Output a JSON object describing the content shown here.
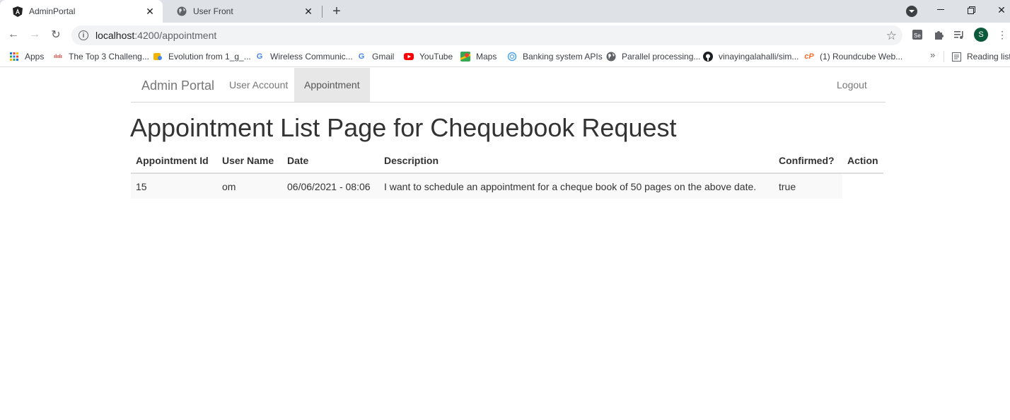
{
  "browser": {
    "tabs": [
      {
        "title": "AdminPortal",
        "active": true,
        "icon": "angular-icon"
      },
      {
        "title": "User Front",
        "active": false,
        "icon": "globe-icon"
      }
    ],
    "url_host": "localhost",
    "url_path": ":4200/appointment",
    "profile_initial": "S",
    "bookmarks": [
      {
        "label": "Apps",
        "icon": "apps-grid-icon"
      },
      {
        "label": "The Top 3 Challeng...",
        "icon": "cisco-icon"
      },
      {
        "label": "Evolution from 1_g_...",
        "icon": "bookmark-icon"
      },
      {
        "label": "Wireless Communic...",
        "icon": "google-icon"
      },
      {
        "label": "Gmail",
        "icon": "google-icon"
      },
      {
        "label": "YouTube",
        "icon": "youtube-icon"
      },
      {
        "label": "Maps",
        "icon": "maps-icon"
      },
      {
        "label": "Banking system APIs",
        "icon": "circle-arrows-icon"
      },
      {
        "label": "Parallel processing...",
        "icon": "globe-icon"
      },
      {
        "label": "vinayingalahalli/sim...",
        "icon": "github-icon"
      },
      {
        "label": "(1) Roundcube Web...",
        "icon": "cpanel-icon"
      }
    ],
    "bookmarks_more": "»",
    "reading_list": "Reading list"
  },
  "navbar": {
    "brand": "Admin Portal",
    "links": [
      "User Account",
      "Appointment"
    ],
    "active": "Appointment",
    "logout": "Logout"
  },
  "page": {
    "title": "Appointment List Page for Chequebook Request"
  },
  "table": {
    "headers": [
      "Appointment Id",
      "User Name",
      "Date",
      "Description",
      "Confirmed?",
      "Action"
    ],
    "rows": [
      [
        "15",
        "om",
        "06/06/2021 - 08:06",
        "I want to schedule an appointment for a cheque book of 50 pages on the above date.",
        "true",
        ""
      ]
    ]
  }
}
